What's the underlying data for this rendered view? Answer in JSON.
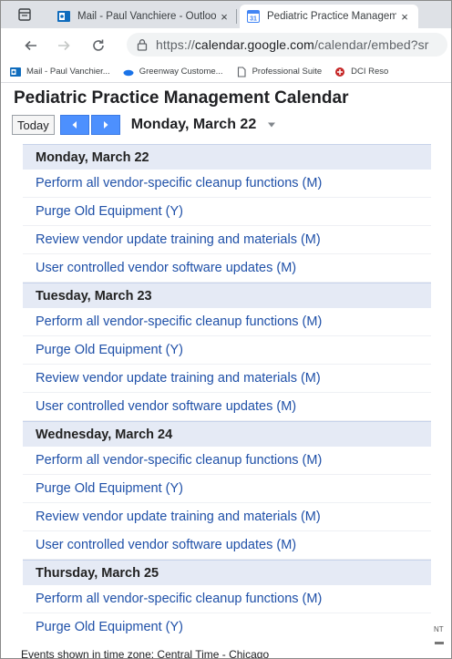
{
  "browser": {
    "tabs": [
      {
        "title": "Mail - Paul Vanchiere - Outlook",
        "active": false
      },
      {
        "title": "Pediatric Practice Management C",
        "active": true
      }
    ],
    "close_glyph": "×",
    "address": {
      "prefix": "https://",
      "host": "calendar.google.com",
      "path": "/calendar/embed?sr"
    },
    "bookmarks": [
      "Mail - Paul Vanchier...",
      "Greenway Custome...",
      "Professional Suite",
      "DCI Reso"
    ]
  },
  "calendar": {
    "title": "Pediatric Practice Management Calendar",
    "today_label": "Today",
    "current_date": "Monday, March 22",
    "days": [
      {
        "date": "Monday, March 22",
        "events": [
          "Perform all vendor-specific cleanup functions (M)",
          "Purge Old Equipment (Y)",
          "Review vendor update training and materials (M)",
          "User controlled vendor software updates (M)"
        ]
      },
      {
        "date": "Tuesday, March 23",
        "events": [
          "Perform all vendor-specific cleanup functions (M)",
          "Purge Old Equipment (Y)",
          "Review vendor update training and materials (M)",
          "User controlled vendor software updates (M)"
        ]
      },
      {
        "date": "Wednesday, March 24",
        "events": [
          "Perform all vendor-specific cleanup functions (M)",
          "Purge Old Equipment (Y)",
          "Review vendor update training and materials (M)",
          "User controlled vendor software updates (M)"
        ]
      },
      {
        "date": "Thursday, March 25",
        "events": [
          "Perform all vendor-specific cleanup functions (M)",
          "Purge Old Equipment (Y)"
        ]
      }
    ],
    "timezone_note": "Events shown in time zone: Central Time - Chicago"
  },
  "side_text": "NT",
  "colors": {
    "event_link": "#1f50a8",
    "day_header_bg": "#e5eaf5",
    "nav_button": "#4d90fe"
  }
}
